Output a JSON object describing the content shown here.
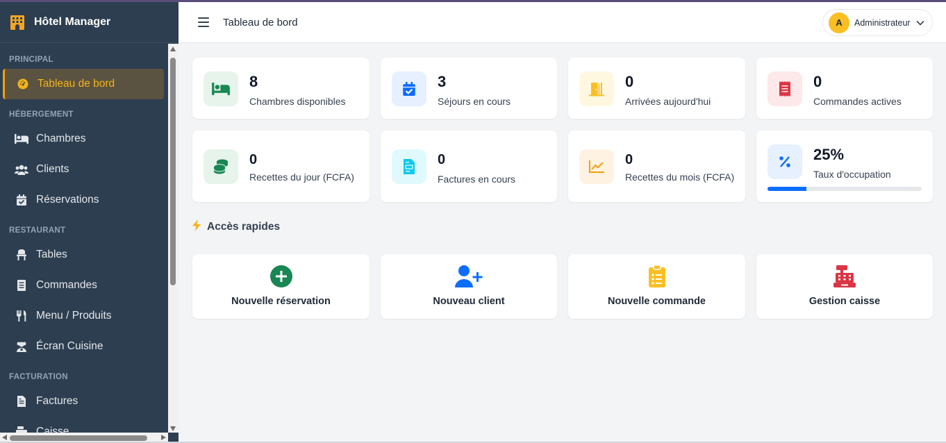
{
  "app": {
    "title": "Hôtel Manager"
  },
  "header": {
    "title": "Tableau de bord",
    "user_initial": "A",
    "user_name": "Administrateur"
  },
  "sidebar": {
    "sections": [
      {
        "label": "PRINCIPAL",
        "items": [
          {
            "label": "Tableau de bord",
            "icon": "gauge-icon",
            "active": true
          }
        ]
      },
      {
        "label": "HÉBERGEMENT",
        "items": [
          {
            "label": "Chambres",
            "icon": "bed-icon"
          },
          {
            "label": "Clients",
            "icon": "users-icon"
          },
          {
            "label": "Réservations",
            "icon": "calendar-check-icon"
          }
        ]
      },
      {
        "label": "RESTAURANT",
        "items": [
          {
            "label": "Tables",
            "icon": "chair-icon"
          },
          {
            "label": "Commandes",
            "icon": "receipt-icon"
          },
          {
            "label": "Menu / Produits",
            "icon": "utensils-icon"
          },
          {
            "label": "Écran Cuisine",
            "icon": "chef-icon"
          }
        ]
      },
      {
        "label": "FACTURATION",
        "items": [
          {
            "label": "Factures",
            "icon": "file-invoice-icon"
          },
          {
            "label": "Caisse",
            "icon": "cash-register-icon"
          }
        ]
      }
    ]
  },
  "stats": [
    {
      "value": "8",
      "label": "Chambres disponibles",
      "icon": "bed-icon",
      "color": "#198754",
      "bg": "#e6f4ec"
    },
    {
      "value": "3",
      "label": "Séjours en cours",
      "icon": "calendar-check-icon",
      "color": "#0d6efd",
      "bg": "#e7f0ff"
    },
    {
      "value": "0",
      "label": "Arrivées aujourd'hui",
      "icon": "door-open-icon",
      "color": "#fbbf24",
      "bg": "#fff8e1"
    },
    {
      "value": "0",
      "label": "Commandes actives",
      "icon": "receipt-icon",
      "color": "#dc3545",
      "bg": "#fde8ea"
    },
    {
      "value": "0",
      "label": "Recettes du jour (FCFA)",
      "icon": "coins-icon",
      "color": "#198754",
      "bg": "#e6f4ec"
    },
    {
      "value": "0",
      "label": "Factures en cours",
      "icon": "file-invoice-icon",
      "color": "#0dcaf0",
      "bg": "#e0f9fd"
    },
    {
      "value": "0",
      "label": "Recettes du mois (FCFA)",
      "icon": "chart-line-icon",
      "color": "#f59e0b",
      "bg": "#fef3e2"
    },
    {
      "value": "25%",
      "label": "Taux d'occupation",
      "icon": "percent-icon",
      "color": "#0d6efd",
      "bg": "#e7f0ff",
      "progress": 0.25
    }
  ],
  "quick_access": {
    "title": "Accès rapides",
    "items": [
      {
        "label": "Nouvelle réservation",
        "icon": "plus-circle-icon",
        "color": "#198754"
      },
      {
        "label": "Nouveau client",
        "icon": "user-plus-icon",
        "color": "#0d6efd"
      },
      {
        "label": "Nouvelle commande",
        "icon": "clipboard-list-icon",
        "color": "#fbbf24"
      },
      {
        "label": "Gestion caisse",
        "icon": "cash-register-icon",
        "color": "#dc3545"
      }
    ]
  }
}
